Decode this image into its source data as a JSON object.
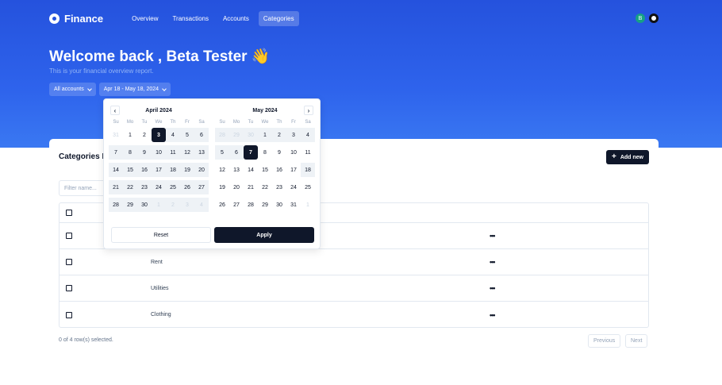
{
  "nav": {
    "brand": "Finance",
    "links": [
      "Overview",
      "Transactions",
      "Accounts",
      "Categories"
    ],
    "active_link": "Categories",
    "avatar_initial": "B",
    "icons": {
      "logo": "finance-logo-icon",
      "github": "github-icon"
    }
  },
  "hero": {
    "welcome": "Welcome back , Beta Tester 👋",
    "subtitle": "This is your financial overview report.",
    "account_filter": "All accounts",
    "date_filter": "Apr 18 - May 18, 2024"
  },
  "card": {
    "title": "Categories P",
    "add_new_label": "Add new",
    "filter_placeholder": "Filter name...",
    "rows": [
      {
        "name": ""
      },
      {
        "name": "Rent"
      },
      {
        "name": "Utilities"
      },
      {
        "name": "Clothing"
      }
    ],
    "row_action_label": "•••",
    "selection_status": "0 of 4 row(s) selected.",
    "previous_label": "Previous",
    "next_label": "Next"
  },
  "calendar": {
    "weekdays": [
      "Su",
      "Mo",
      "Tu",
      "We",
      "Th",
      "Fr",
      "Sa"
    ],
    "months": [
      {
        "title": "April 2024",
        "weeks": [
          [
            {
              "d": "31",
              "o": true
            },
            {
              "d": "1"
            },
            {
              "d": "2"
            },
            {
              "d": "3",
              "s": true
            },
            {
              "d": "4",
              "r": true
            },
            {
              "d": "5",
              "r": true
            },
            {
              "d": "6",
              "r": true
            }
          ],
          [
            {
              "d": "7",
              "r": true
            },
            {
              "d": "8",
              "r": true
            },
            {
              "d": "9",
              "r": true
            },
            {
              "d": "10",
              "r": true
            },
            {
              "d": "11",
              "r": true
            },
            {
              "d": "12",
              "r": true
            },
            {
              "d": "13",
              "r": true
            }
          ],
          [
            {
              "d": "14",
              "r": true
            },
            {
              "d": "15",
              "r": true
            },
            {
              "d": "16",
              "r": true
            },
            {
              "d": "17",
              "r": true
            },
            {
              "d": "18",
              "r": true
            },
            {
              "d": "19",
              "r": true
            },
            {
              "d": "20",
              "r": true
            }
          ],
          [
            {
              "d": "21",
              "r": true
            },
            {
              "d": "22",
              "r": true
            },
            {
              "d": "23",
              "r": true
            },
            {
              "d": "24",
              "r": true
            },
            {
              "d": "25",
              "r": true
            },
            {
              "d": "26",
              "r": true
            },
            {
              "d": "27",
              "r": true
            }
          ],
          [
            {
              "d": "28",
              "r": true
            },
            {
              "d": "29",
              "r": true
            },
            {
              "d": "30",
              "r": true
            },
            {
              "d": "1",
              "o": true,
              "r": true
            },
            {
              "d": "2",
              "o": true,
              "r": true
            },
            {
              "d": "3",
              "o": true,
              "r": true
            },
            {
              "d": "4",
              "o": true,
              "r": true
            }
          ]
        ]
      },
      {
        "title": "May 2024",
        "weeks": [
          [
            {
              "d": "28",
              "o": true,
              "r": true
            },
            {
              "d": "29",
              "o": true,
              "r": true
            },
            {
              "d": "30",
              "o": true,
              "r": true
            },
            {
              "d": "1",
              "r": true
            },
            {
              "d": "2",
              "r": true
            },
            {
              "d": "3",
              "r": true
            },
            {
              "d": "4",
              "r": true
            }
          ],
          [
            {
              "d": "5",
              "r": true
            },
            {
              "d": "6",
              "r": true
            },
            {
              "d": "7",
              "s": true
            },
            {
              "d": "8"
            },
            {
              "d": "9"
            },
            {
              "d": "10"
            },
            {
              "d": "11"
            }
          ],
          [
            {
              "d": "12"
            },
            {
              "d": "13"
            },
            {
              "d": "14"
            },
            {
              "d": "15"
            },
            {
              "d": "16"
            },
            {
              "d": "17"
            },
            {
              "d": "18",
              "r": true
            }
          ],
          [
            {
              "d": "19"
            },
            {
              "d": "20"
            },
            {
              "d": "21"
            },
            {
              "d": "22"
            },
            {
              "d": "23"
            },
            {
              "d": "24"
            },
            {
              "d": "25"
            }
          ],
          [
            {
              "d": "26"
            },
            {
              "d": "27"
            },
            {
              "d": "28"
            },
            {
              "d": "29"
            },
            {
              "d": "30"
            },
            {
              "d": "31"
            },
            {
              "d": "1",
              "o": true
            }
          ]
        ]
      }
    ],
    "prev_symbol": "‹",
    "next_symbol": "›",
    "reset_label": "Reset",
    "apply_label": "Apply"
  },
  "colors": {
    "hero": "#2552dd",
    "primary": "#0f172a",
    "range": "#eef2f6"
  }
}
